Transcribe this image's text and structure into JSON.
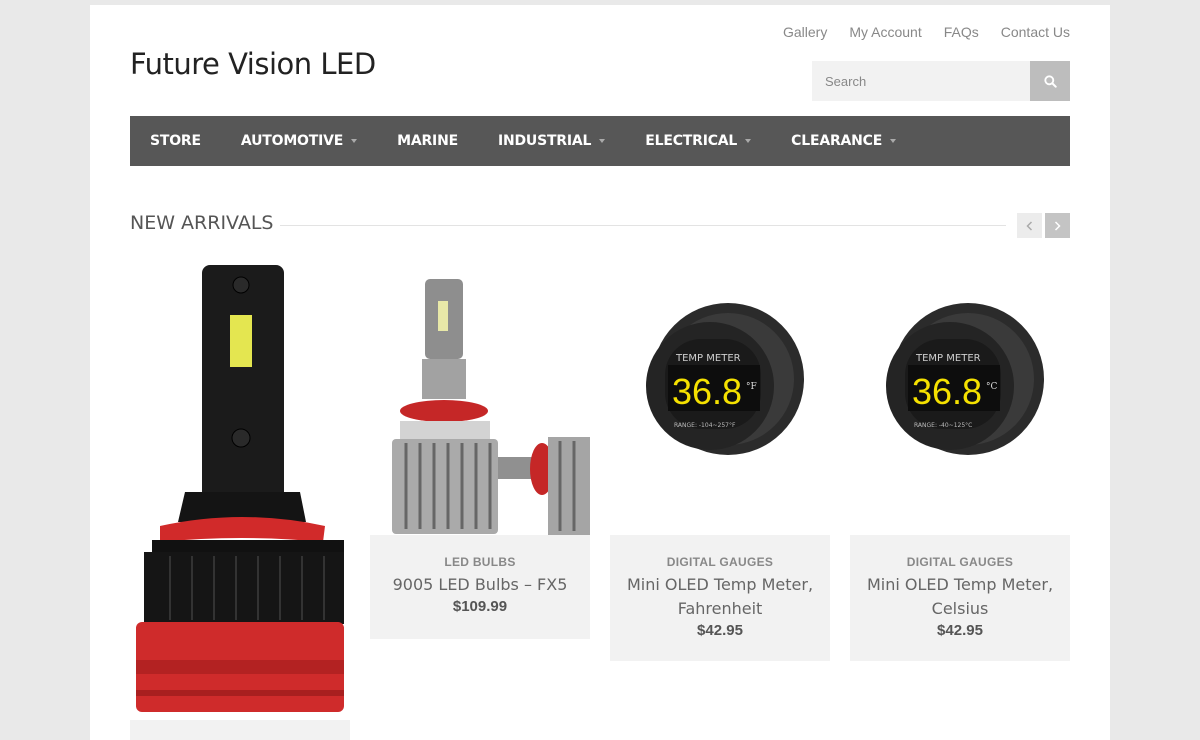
{
  "site": {
    "logo": "Future Vision LED"
  },
  "top_links": [
    "Gallery",
    "My Account",
    "FAQs",
    "Contact Us"
  ],
  "search": {
    "placeholder": "Search",
    "icon": "search-icon"
  },
  "nav": [
    {
      "label": "STORE",
      "dropdown": false
    },
    {
      "label": "AUTOMOTIVE",
      "dropdown": true
    },
    {
      "label": "MARINE",
      "dropdown": false
    },
    {
      "label": "INDUSTRIAL",
      "dropdown": true
    },
    {
      "label": "ELECTRICAL",
      "dropdown": true
    },
    {
      "label": "CLEARANCE",
      "dropdown": true
    }
  ],
  "section": {
    "title": "NEW ARRIVALS"
  },
  "products": [
    {
      "category": "",
      "name": "",
      "price": "",
      "image": "led-headlight-bulb-red-black"
    },
    {
      "category": "LED BULBS",
      "name": "9005 LED Bulbs – FX5",
      "price": "$109.99",
      "image": "led-bulb-pair-silver-red"
    },
    {
      "category": "DIGITAL GAUGES",
      "name": "Mini OLED Temp Meter, Fahrenheit",
      "price": "$42.95",
      "image": "temp-meter-fahrenheit",
      "display": {
        "reading": "36.8",
        "unit": "°F",
        "header": "TEMP METER",
        "range": "RANGE: -104~257°F"
      }
    },
    {
      "category": "DIGITAL GAUGES",
      "name": "Mini OLED Temp Meter, Celsius",
      "price": "$42.95",
      "image": "temp-meter-celsius",
      "display": {
        "reading": "36.8",
        "unit": "°C",
        "header": "TEMP METER",
        "range": "RANGE: -40~125°C"
      }
    }
  ],
  "colors": {
    "nav_bg": "#575757",
    "page_bg": "#e9e9e9",
    "card_bg": "#f2f2f2",
    "gauge_text": "#f5e100"
  }
}
